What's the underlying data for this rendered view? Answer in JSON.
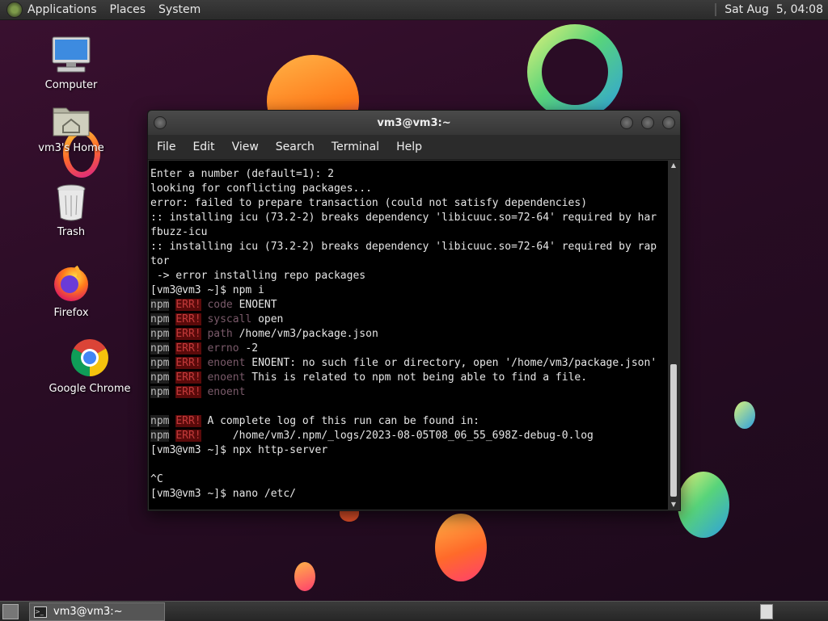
{
  "top_panel": {
    "menus": [
      "Applications",
      "Places",
      "System"
    ],
    "clock": "Sat Aug  5, 04:08"
  },
  "desktop_icons": [
    {
      "label": "Computer",
      "icon": "computer-icon"
    },
    {
      "label": "vm3's Home",
      "icon": "home-folder-icon"
    },
    {
      "label": "Trash",
      "icon": "trash-icon"
    },
    {
      "label": "Firefox",
      "icon": "firefox-icon"
    },
    {
      "label": "Google Chrome",
      "icon": "chrome-icon"
    }
  ],
  "window": {
    "title": "vm3@vm3:~",
    "menu": [
      "File",
      "Edit",
      "View",
      "Search",
      "Terminal",
      "Help"
    ]
  },
  "terminal": {
    "lines": [
      "Enter a number (default=1): 2",
      "looking for conflicting packages...",
      "error: failed to prepare transaction (could not satisfy dependencies)",
      ":: installing icu (73.2-2) breaks dependency 'libicuuc.so=72-64' required by har",
      "fbuzz-icu",
      ":: installing icu (73.2-2) breaks dependency 'libicuuc.so=72-64' required by rap",
      "tor",
      " -> error installing repo packages",
      "[vm3@vm3 ~]$ npm i"
    ],
    "npm_lines": [
      {
        "tag": "npm",
        "level": "ERR!",
        "key": "code",
        "text": "ENOENT"
      },
      {
        "tag": "npm",
        "level": "ERR!",
        "key": "syscall",
        "text": "open"
      },
      {
        "tag": "npm",
        "level": "ERR!",
        "key": "path",
        "text": "/home/vm3/package.json"
      },
      {
        "tag": "npm",
        "level": "ERR!",
        "key": "errno",
        "text": "-2"
      },
      {
        "tag": "npm",
        "level": "ERR!",
        "key": "enoent",
        "text": "ENOENT: no such file or directory, open '/home/vm3/package.json'"
      },
      {
        "tag": "npm",
        "level": "ERR!",
        "key": "enoent",
        "text": "This is related to npm not being able to find a file."
      },
      {
        "tag": "npm",
        "level": "ERR!",
        "key": "enoent",
        "text": ""
      }
    ],
    "log_lines": [
      {
        "tag": "npm",
        "level": "ERR!",
        "text": "A complete log of this run can be found in:"
      },
      {
        "tag": "npm",
        "level": "ERR!",
        "text": "    /home/vm3/.npm/_logs/2023-08-05T08_06_55_698Z-debug-0.log"
      }
    ],
    "tail_lines": [
      "[vm3@vm3 ~]$ npx http-server",
      "",
      "^C",
      "[vm3@vm3 ~]$ nano /etc/"
    ]
  },
  "taskbar": {
    "task_label": "vm3@vm3:~"
  },
  "colors": {
    "desktop_bg": "#2a0c25",
    "npm_err_bg": "#5a0a0a",
    "npm_err_fg": "#c23a3a"
  }
}
